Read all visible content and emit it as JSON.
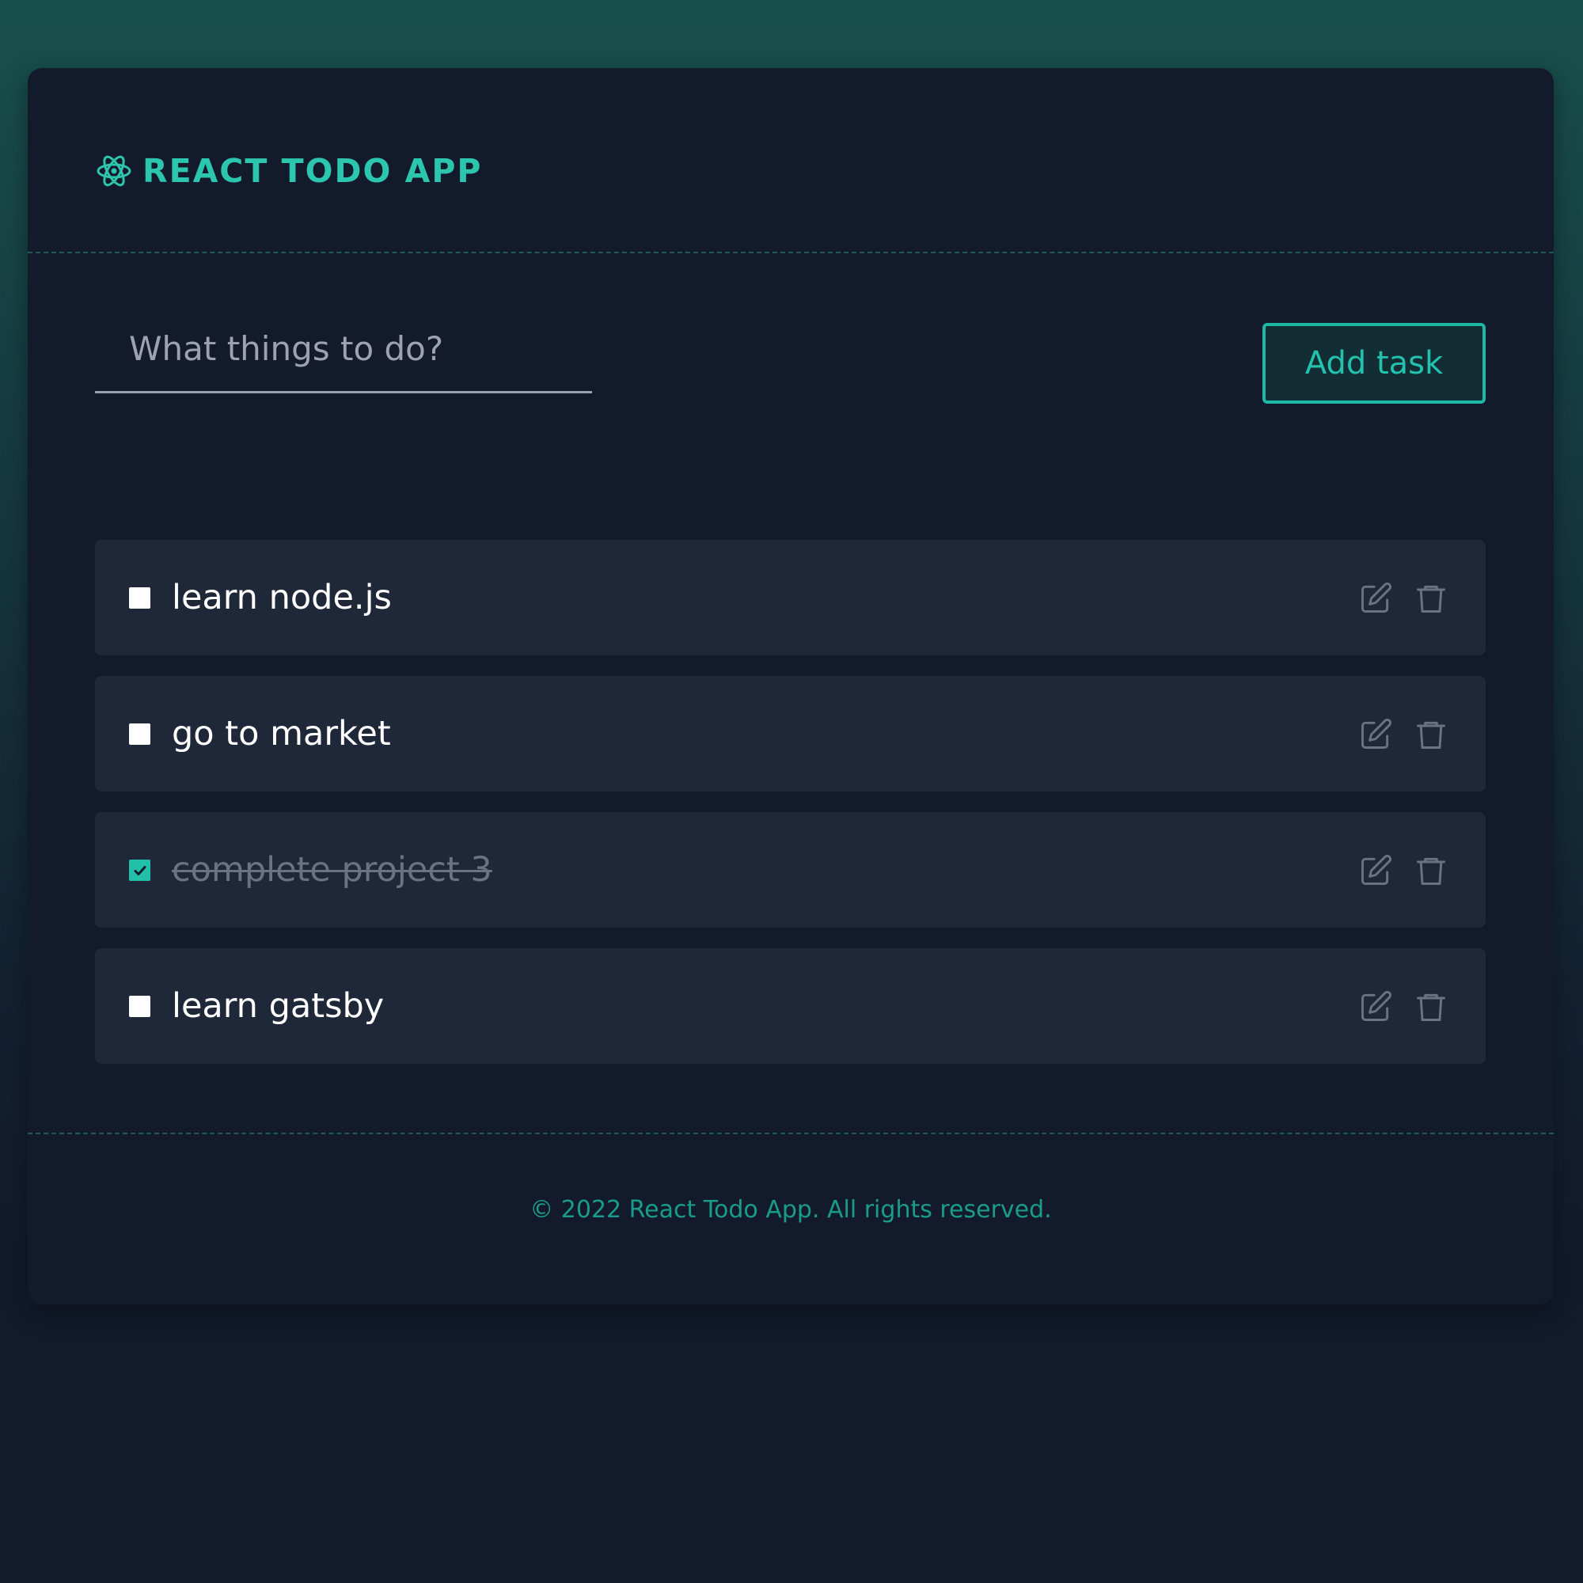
{
  "colors": {
    "accent": "#1fb8a5",
    "title": "#2cc5ad",
    "card_bg": "#131a2b",
    "item_bg": "#1f2838",
    "footer_text": "#1a9c8c"
  },
  "header": {
    "logo_icon": "react-atom-icon",
    "title": "REACT TODO APP"
  },
  "form": {
    "placeholder": "What things to do?",
    "value": "",
    "add_label": "Add task"
  },
  "todos": [
    {
      "text": "learn node.js",
      "completed": false,
      "edit_icon": "edit-icon",
      "delete_icon": "trash-icon"
    },
    {
      "text": "go to market",
      "completed": false,
      "edit_icon": "edit-icon",
      "delete_icon": "trash-icon"
    },
    {
      "text": "complete project 3",
      "completed": true,
      "edit_icon": "edit-icon",
      "delete_icon": "trash-icon"
    },
    {
      "text": "learn gatsby",
      "completed": false,
      "edit_icon": "edit-icon",
      "delete_icon": "trash-icon"
    }
  ],
  "footer": {
    "text": "© 2022 React Todo App. All rights reserved."
  }
}
